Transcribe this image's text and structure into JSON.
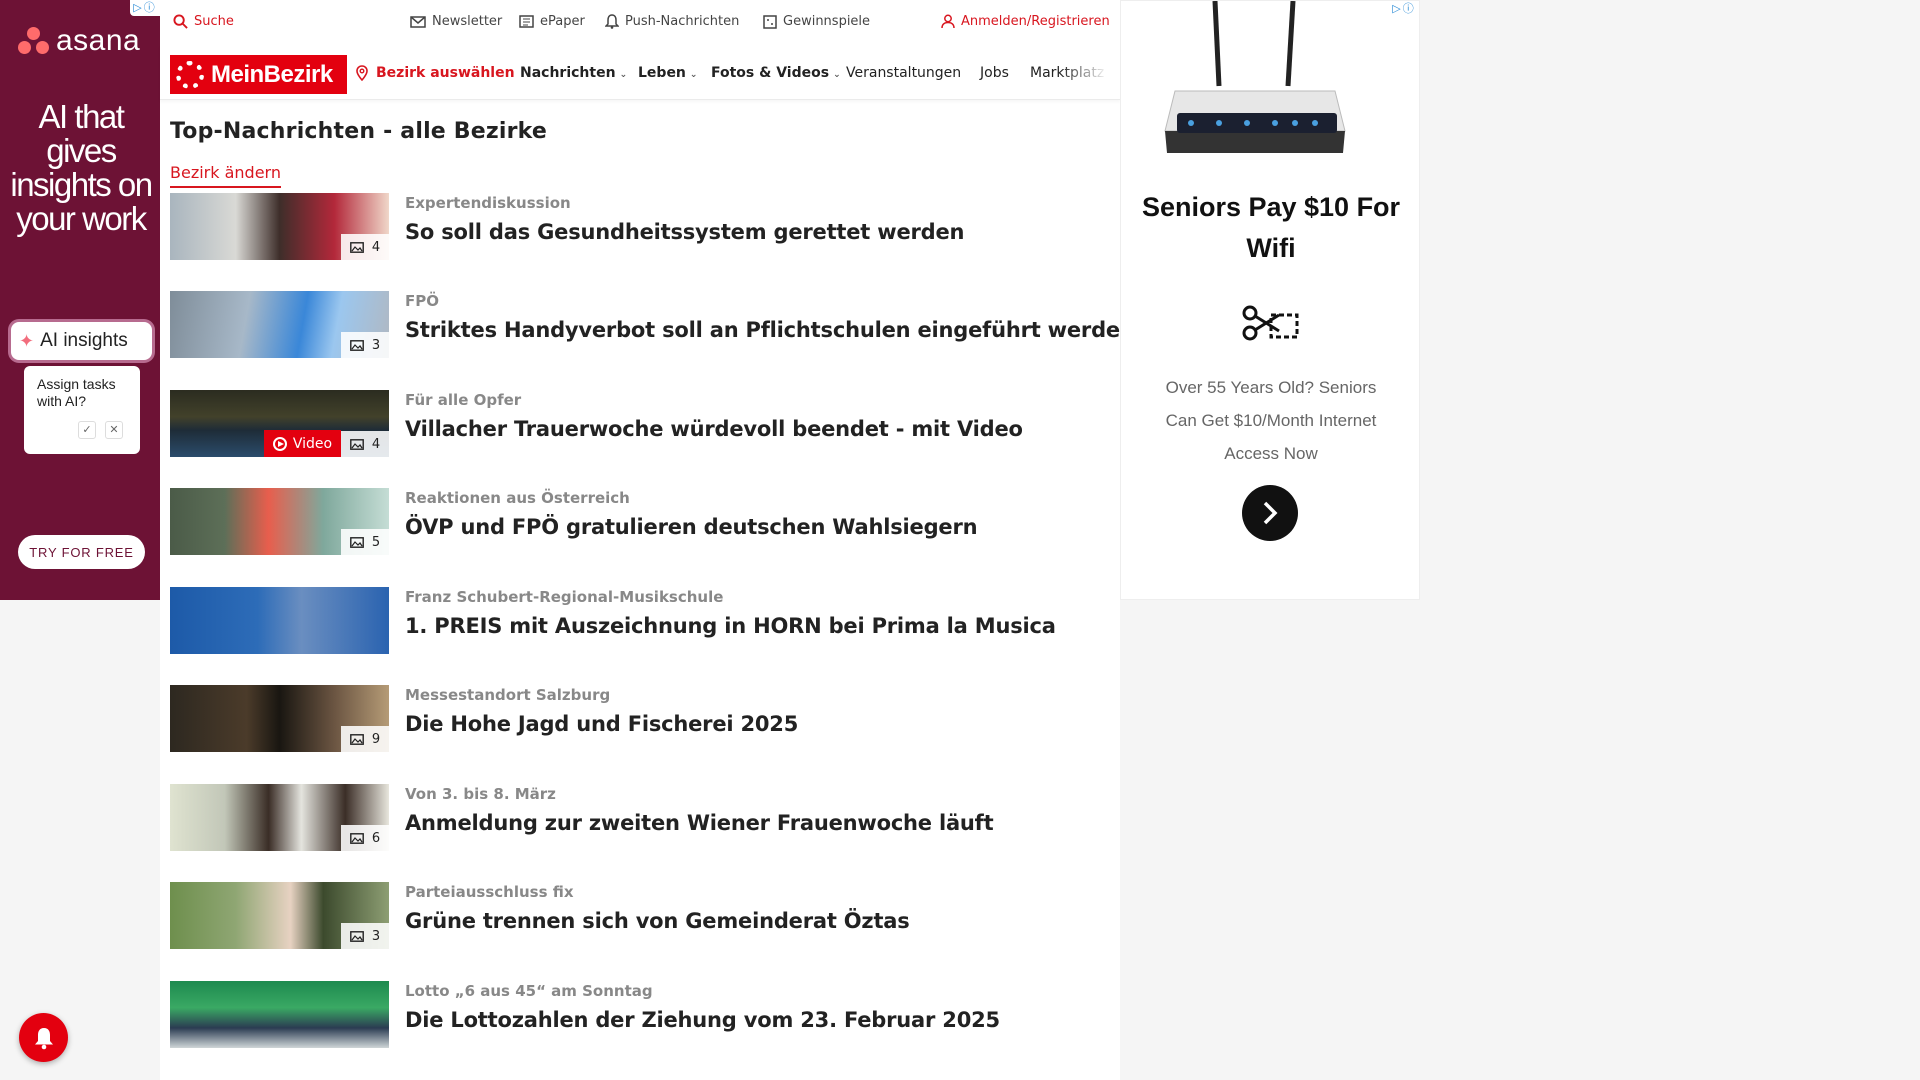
{
  "ad_left": {
    "brand": "asana",
    "headline": "AI that gives insights on your work",
    "pill": "AI insights",
    "card_text": "Assign tasks with AI?",
    "cta": "TRY FOR FREE",
    "colors": {
      "background": "#6d1235",
      "logo": "#ff6b6b"
    }
  },
  "topbar": {
    "search": "Suche",
    "newsletter": "Newsletter",
    "epaper": "ePaper",
    "push": "Push-Nachrichten",
    "gewinnspiele": "Gewinnspiele",
    "login": "Anmelden/Registrieren"
  },
  "navbar": {
    "logo": "MeinBezirk",
    "bezirk": "Bezirk auswählen",
    "items": [
      "Nachrichten",
      "Leben",
      "Fotos & Videos",
      "Veranstaltungen",
      "Jobs",
      "Marktplatz"
    ]
  },
  "page": {
    "title": "Top-Nachrichten - alle Bezirke",
    "bezirk_link": "Bezirk ändern"
  },
  "articles": [
    {
      "kicker": "Expertendiskussion",
      "headline": "So soll das Gesundheitssystem gerettet werden",
      "images": "4"
    },
    {
      "kicker": "FPÖ",
      "headline": "Striktes Handyverbot soll an Pflichtschulen eingeführt werden",
      "images": "3"
    },
    {
      "kicker": "Für alle Opfer",
      "headline": "Villacher Trauerwoche würdevoll beendet - mit Video",
      "images": "4",
      "video": "Video"
    },
    {
      "kicker": "Reaktionen aus Österreich",
      "headline": "ÖVP und FPÖ gratulieren deutschen Wahlsiegern",
      "images": "5"
    },
    {
      "kicker": "Franz Schubert-Regional-Musikschule",
      "headline": "1. PREIS mit Auszeichnung in HORN bei Prima la Musica",
      "images": ""
    },
    {
      "kicker": "Messestandort Salzburg",
      "headline": "Die Hohe Jagd und Fischerei 2025",
      "images": "9"
    },
    {
      "kicker": "Von 3. bis 8. März",
      "headline": "Anmeldung zur zweiten Wiener Frauenwoche läuft",
      "images": "6"
    },
    {
      "kicker": "Parteiausschluss fix",
      "headline": "Grüne trennen sich von Gemeinderat Öztas",
      "images": "3"
    },
    {
      "kicker": "Lotto „6 aus 45“ am Sonntag",
      "headline": "Die Lottozahlen der Ziehung vom 23. Februar 2025",
      "images": ""
    }
  ],
  "ad_right": {
    "title": "Seniors Pay $10 For Wifi",
    "text": "Over 55 Years Old? Seniors Can Get $10/Month Internet Access Now"
  },
  "colors": {
    "accent": "#d8161f",
    "brand": "#e3000f"
  }
}
